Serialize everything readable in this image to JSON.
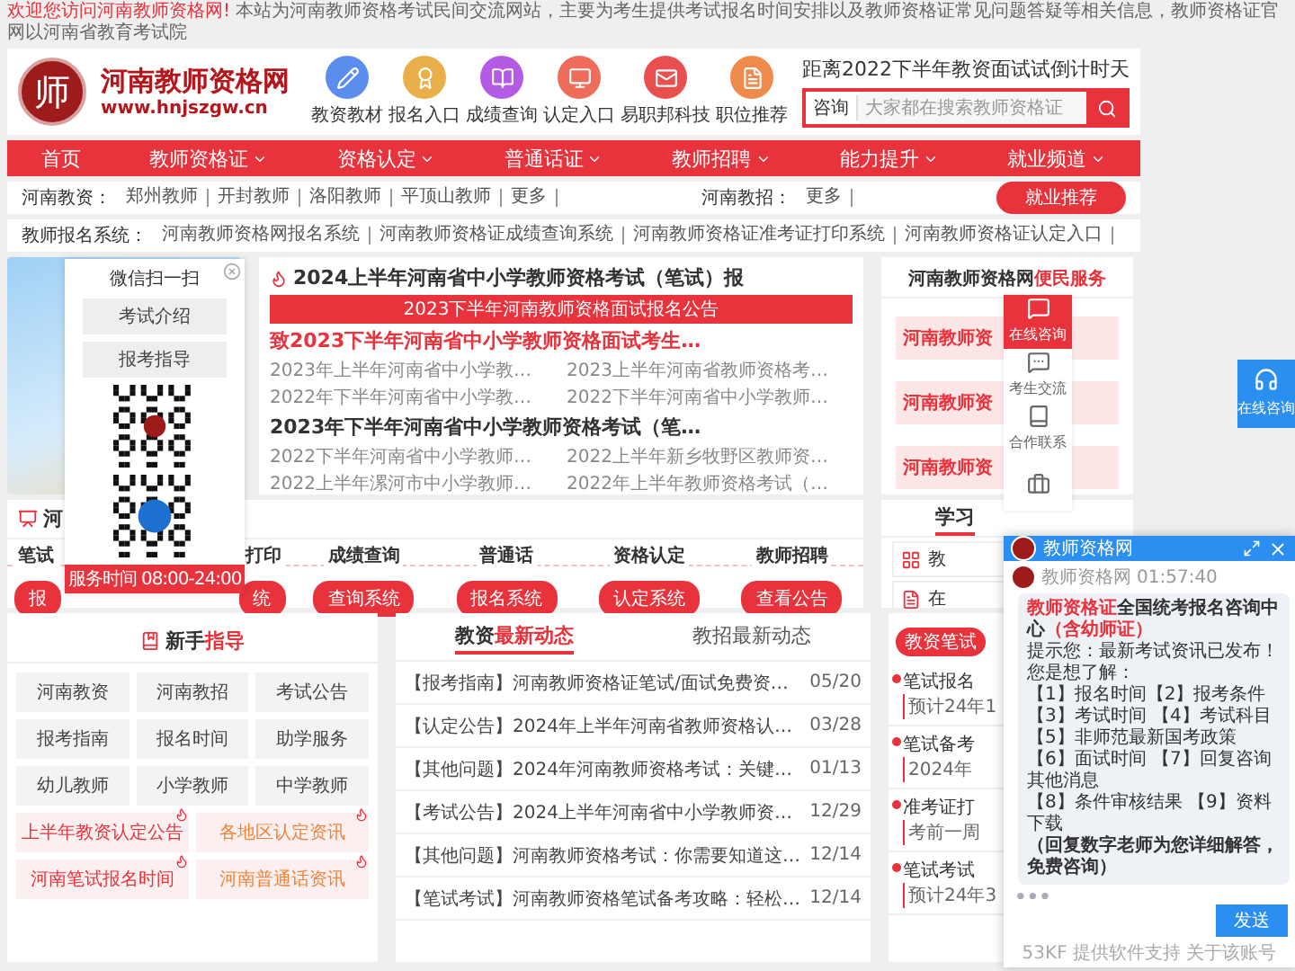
{
  "notice": {
    "lead": "欢迎您访问河南教师资格网!",
    "text": " 本站为河南教师资格考试民间交流网站，主要为考生提供考试报名时间安排以及教师资格证常见问题答疑等相关信息，教师资格证官网以河南省教育考试院"
  },
  "header": {
    "logo_char": "师",
    "logo_title": "河南教师资格网",
    "logo_url": "www.hnjszgw.cn",
    "shortcuts": [
      {
        "label": "教资教材",
        "kind": "pencil",
        "color": "#5b8def"
      },
      {
        "label": "报名入口",
        "kind": "award",
        "color": "#e9b04a"
      },
      {
        "label": "成绩查询",
        "kind": "book",
        "color": "#b45be6"
      },
      {
        "label": "认定入口",
        "kind": "monitor",
        "color": "#ef6b5a"
      },
      {
        "label": "易职邦科技",
        "kind": "mail",
        "color": "#ea4f4f"
      },
      {
        "label": "职位推荐",
        "kind": "file",
        "color": "#f08a4b"
      }
    ],
    "countdown": "距离2022下半年教资面试试倒计时天",
    "search": {
      "label": "咨询",
      "placeholder": "大家都在搜索教师资格证"
    }
  },
  "nav": [
    {
      "label": "首页",
      "dropdown": false
    },
    {
      "label": "教师资格证",
      "dropdown": true
    },
    {
      "label": "资格认定",
      "dropdown": true
    },
    {
      "label": "普通话证",
      "dropdown": true
    },
    {
      "label": "教师招聘",
      "dropdown": true
    },
    {
      "label": "能力提升",
      "dropdown": true
    },
    {
      "label": "就业频道",
      "dropdown": true
    }
  ],
  "regions": {
    "label": "河南教资：",
    "links": [
      "郑州教师",
      "开封教师",
      "洛阳教师",
      "平顶山教师",
      "更多"
    ],
    "recruit_label": "河南教招：",
    "recruit_links": [
      "更多"
    ],
    "button": "就业推荐"
  },
  "systems_links": {
    "label": "教师报名系统：",
    "links": [
      "河南教师资格网报名系统",
      "河南教师资格证成绩查询系统",
      "河南教师资格证准考证打印系统",
      "河南教师资格证认定入口"
    ]
  },
  "wechat_popup": {
    "title": "微信扫一扫",
    "buttons": [
      "考试介绍",
      "报考指导"
    ],
    "hours": "服务时间 08:00-24:00"
  },
  "news": {
    "headline": "2024上半年河南省中小学教师资格考试（笔试）报",
    "banner": "2023下半年河南教师资格面试报名公告",
    "groups": [
      {
        "title": "致2023下半年河南省中小学教师资格面试考生…",
        "accent": true,
        "links": [
          "2023年上半年河南省中小学教…",
          "2023上半年河南省教师资格考…",
          "2022年下半年河南省中小学教…",
          "2022下半年河南省中小学教师…"
        ]
      },
      {
        "title": "2023年下半年河南省中小学教师资格考试（笔…",
        "accent": false,
        "links": [
          "2022下半年河南省中小学教师…",
          "2022上半年新乡牧野区教师资…",
          "2022上半年漯河市中小学教师…",
          "2022年上半年教师资格考试（…"
        ]
      }
    ]
  },
  "service": {
    "title": "河南教师资格网",
    "accent": "便民服务",
    "buttons": [
      "河南教师资",
      "河南教师资",
      "河南教师资"
    ]
  },
  "side_tools": [
    {
      "label": "在线咨询",
      "kind": "chat",
      "selected": true
    },
    {
      "label": "考生交流",
      "kind": "message",
      "selected": false
    },
    {
      "label": "合作联系",
      "kind": "book",
      "selected": false
    },
    {
      "kind": "briefcase",
      "selected": false
    }
  ],
  "float_button": {
    "label": "在线咨询"
  },
  "systems": {
    "title": "河",
    "items": [
      {
        "title": "笔试",
        "button": "报",
        "kind": "left"
      },
      {
        "title": "打印",
        "button": "统",
        "kind": "right"
      },
      {
        "title": "成绩查询",
        "button": "查询系统",
        "kind": "whole"
      },
      {
        "title": "普通话",
        "button": "报名系统",
        "kind": "whole"
      },
      {
        "title": "资格认定",
        "button": "认定系统",
        "kind": "whole"
      },
      {
        "title": "教师招聘",
        "button": "查看公告",
        "kind": "whole"
      }
    ]
  },
  "study": {
    "tab": "学习",
    "rows": [
      {
        "label": "教",
        "kind": "grid"
      },
      {
        "label": "在",
        "kind": "doc"
      }
    ]
  },
  "guide": {
    "title": "新手",
    "accent": "指导",
    "links": [
      "河南教资",
      "河南教招",
      "考试公告",
      "报考指南",
      "报名时间",
      "助学服务",
      "幼儿教师",
      "小学教师",
      "中学教师"
    ],
    "hot_links": [
      {
        "label": "上半年教资认定公告",
        "color": "#e8323c"
      },
      {
        "label": "各地区认定资讯",
        "color": "#f0843c"
      },
      {
        "label": "河南笔试报名时间",
        "color": "#e8323c"
      },
      {
        "label": "河南普通话资讯",
        "color": "#f0843c"
      }
    ]
  },
  "updates": {
    "tabs": [
      {
        "label": "教资",
        "accent": "最新动态",
        "selected": true
      },
      {
        "label": "教招最新动态",
        "selected": false
      }
    ],
    "rows": [
      {
        "title": "【报考指南】河南教师资格证笔试/面试免费资…",
        "date": "05/20"
      },
      {
        "title": "【认定公告】2024年上半年河南省教师资格认…",
        "date": "03/28"
      },
      {
        "title": "【其他问题】2024年河南教师资格考试：关键…",
        "date": "01/13"
      },
      {
        "title": "【考试公告】2024上半年河南省中小学教师资…",
        "date": "12/29"
      },
      {
        "title": "【其他问题】河南教师资格考试：你需要知道这…",
        "date": "12/14"
      },
      {
        "title": "【笔试考试】河南教师资格笔试备考攻略：轻松…",
        "date": "12/14"
      }
    ]
  },
  "written_exam": {
    "badge": "教资笔试",
    "items": [
      {
        "title": "笔试报名",
        "note": "预计24年1"
      },
      {
        "title": "笔试备考",
        "note": "2024年"
      },
      {
        "title": "准考证打",
        "note": "考前一周"
      },
      {
        "title": "笔试考试",
        "note": "预计24年3"
      }
    ]
  },
  "chat": {
    "title": "教师资格网",
    "sender": "教师资格网",
    "time": "01:57:40",
    "brand": "教师资格证",
    "heading": "全国统考报名咨询中心",
    "note": "（含幼师证）",
    "lines": [
      "提示您：最新考试资讯已发布！您是想了解：",
      "【1】报名时间【2】报考条件",
      "【3】考试时间 【4】考试科目",
      "【5】非师范最新国考政策",
      "【6】面试时间 【7】回复咨询其他消息",
      "【8】条件审核结果 【9】资料下载"
    ],
    "closing": "（回复数字老师为您详细解答，免费咨询）",
    "send": "发送",
    "footer": "53KF 提供软件支持  关于该账号"
  }
}
